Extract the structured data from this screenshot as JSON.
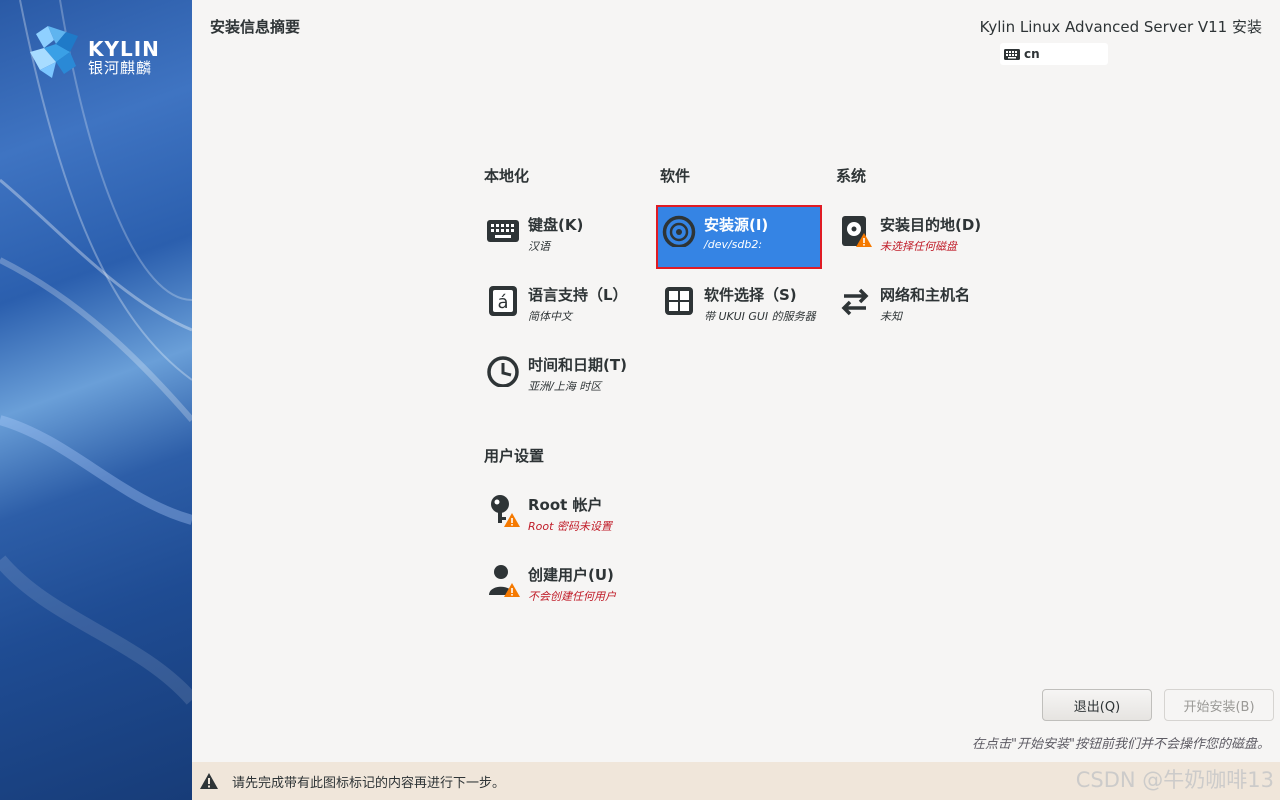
{
  "sidebar": {
    "logo_en": "KYLIN",
    "logo_cn": "银河麒麟"
  },
  "header": {
    "page_title": "安装信息摘要",
    "product_title": "Kylin Linux Advanced Server V11 安装",
    "keyboard_layout": "cn"
  },
  "sections": {
    "localization": {
      "label": "本地化",
      "keyboard": {
        "title": "键盘(K)",
        "status": "汉语"
      },
      "language": {
        "title": "语言支持（L）",
        "status": "简体中文"
      },
      "time": {
        "title": "时间和日期(T)",
        "status": "亚洲/上海 时区"
      }
    },
    "software": {
      "label": "软件",
      "source": {
        "title": "安装源(I)",
        "status": "/dev/sdb2:"
      },
      "selection": {
        "title": "软件选择（S)",
        "status": "带 UKUI GUI 的服务器"
      }
    },
    "system": {
      "label": "系统",
      "destination": {
        "title": "安装目的地(D)",
        "status": "未选择任何磁盘"
      },
      "network": {
        "title": "网络和主机名",
        "status": "未知"
      }
    },
    "user": {
      "label": "用户设置",
      "root": {
        "title": "Root 帐户",
        "status": "Root 密码未设置"
      },
      "create_user": {
        "title": "创建用户(U)",
        "status": "不会创建任何用户"
      }
    }
  },
  "buttons": {
    "quit": "退出(Q)",
    "begin": "开始安装(B)"
  },
  "note": "在点击\"开始安装\"按钮前我们并不会操作您的磁盘。",
  "warning_bar": {
    "text": "请先完成带有此图标标记的内容再进行下一步。"
  },
  "watermark": "CSDN @牛奶咖啡13",
  "colors": {
    "accent": "#3584e4",
    "warning": "#f57900",
    "error_text": "#c01c28"
  }
}
